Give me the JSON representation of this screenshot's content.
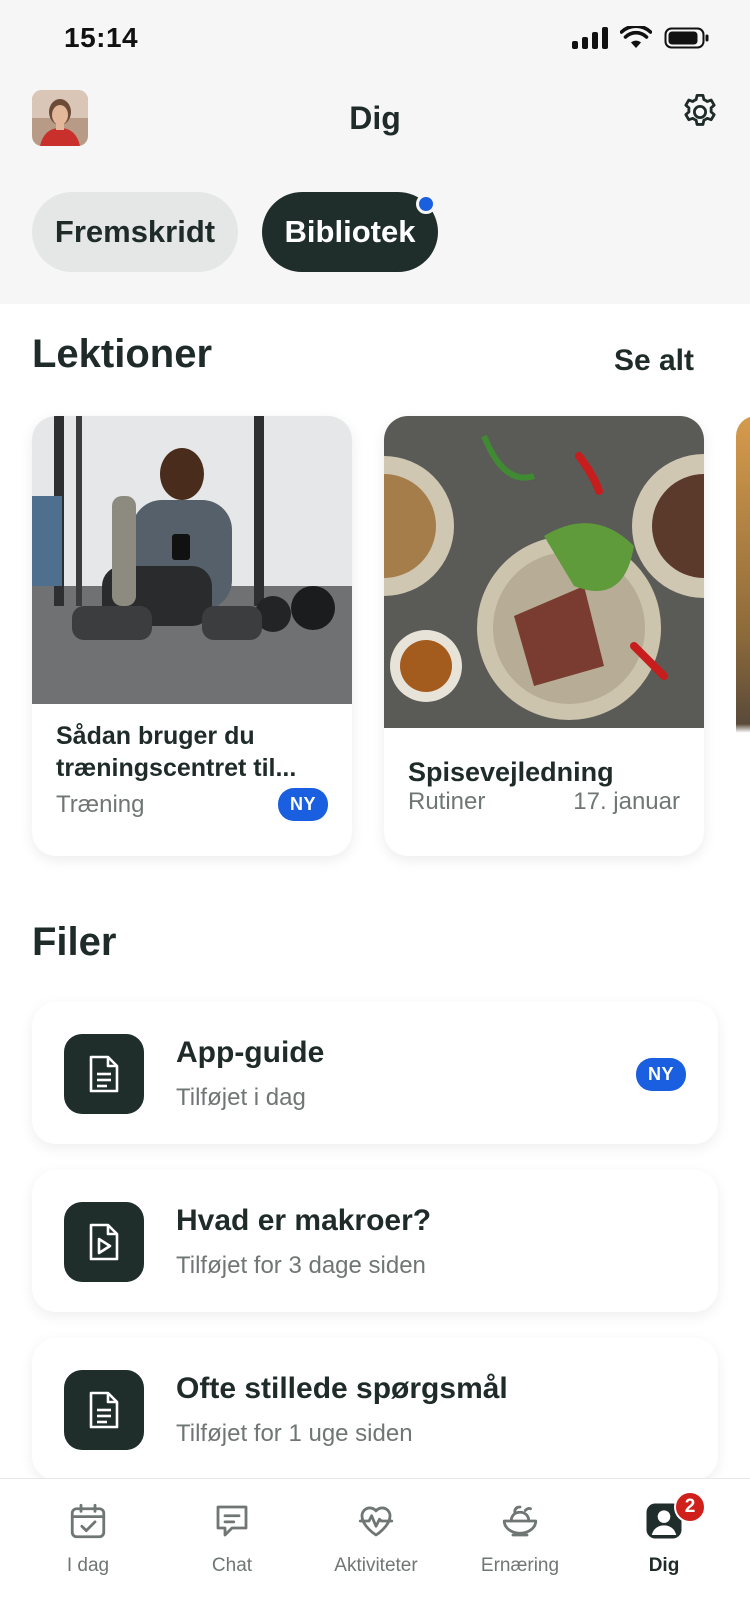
{
  "status_bar": {
    "time": "15:14"
  },
  "header": {
    "title": "Dig"
  },
  "segments": {
    "progress_label": "Fremskridt",
    "library_label": "Bibliotek"
  },
  "lessons": {
    "title": "Lektioner",
    "see_all": "Se alt",
    "cards": [
      {
        "title_line1": "Sådan bruger du",
        "title_line2": "træningscentret til...",
        "category": "Træning",
        "badge": "NY"
      },
      {
        "title": "Spisevejledning",
        "category": "Rutiner",
        "date": "17. januar"
      }
    ]
  },
  "files": {
    "title": "Filer",
    "items": [
      {
        "title": "App-guide",
        "subtitle": "Tilføjet i dag",
        "badge": "NY",
        "icon": "document-icon"
      },
      {
        "title": "Hvad er makroer?",
        "subtitle": "Tilføjet for 3 dage siden",
        "icon": "video-file-icon"
      },
      {
        "title": "Ofte stillede spørgsmål",
        "subtitle": "Tilføjet for 1 uge siden",
        "icon": "document-icon"
      }
    ]
  },
  "tabbar": {
    "items": [
      {
        "label": "I dag",
        "icon": "calendar-check-icon"
      },
      {
        "label": "Chat",
        "icon": "chat-icon"
      },
      {
        "label": "Aktiviteter",
        "icon": "heart-pulse-icon"
      },
      {
        "label": "Ernæring",
        "icon": "food-bowl-icon"
      },
      {
        "label": "Dig",
        "icon": "profile-icon",
        "notification_count": "2"
      }
    ]
  },
  "colors": {
    "accent_blue": "#1a5fe0",
    "dark": "#1f2d2b",
    "notification_red": "#d0201c"
  }
}
